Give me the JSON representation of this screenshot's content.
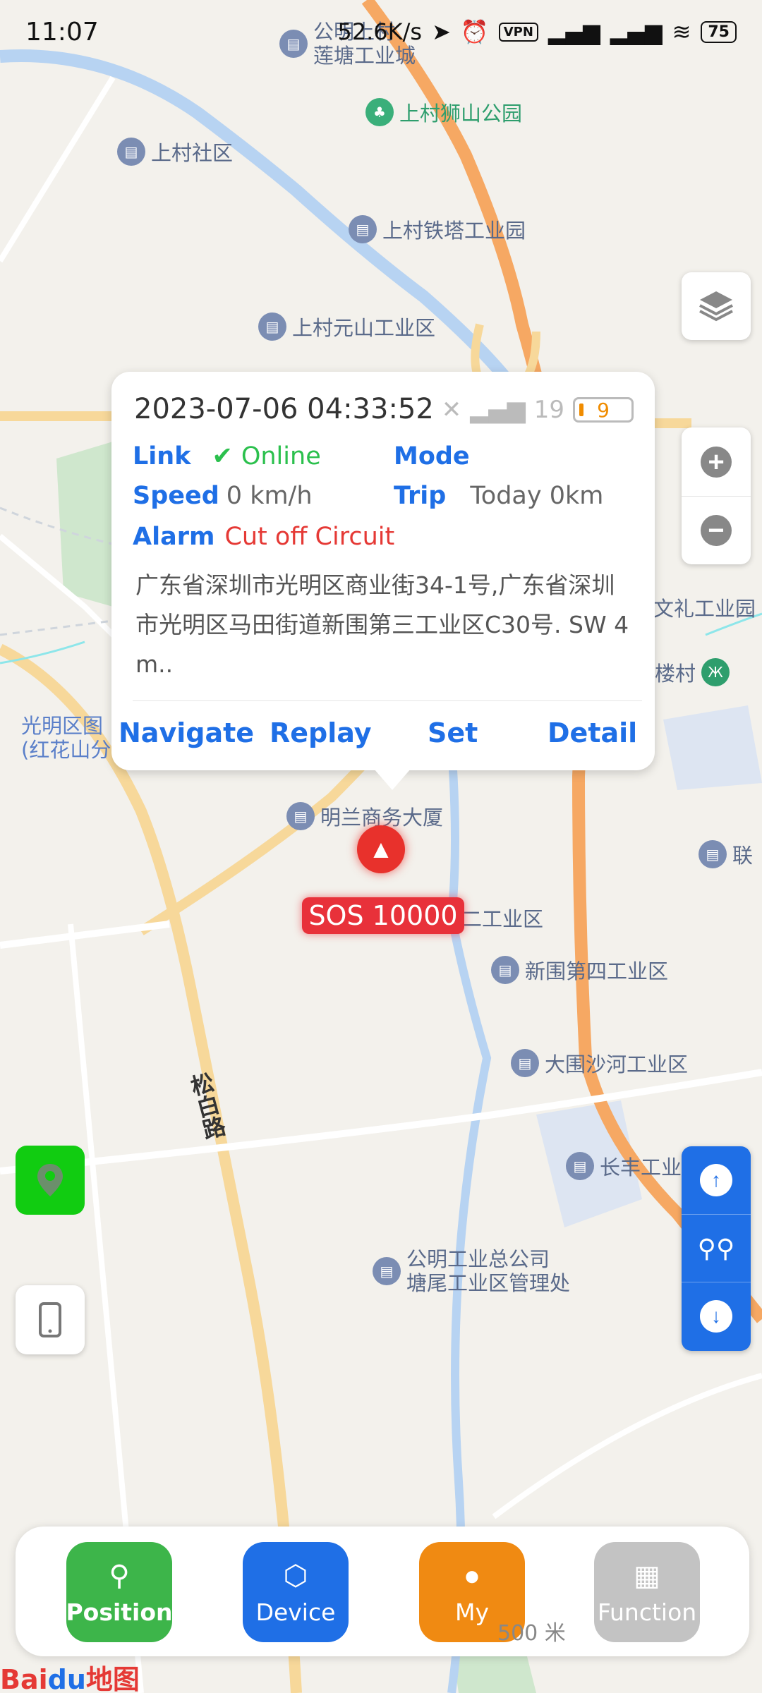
{
  "status_bar": {
    "time": "11:07",
    "speed": "52.6K/s",
    "vpn": "VPN",
    "battery": "75"
  },
  "map": {
    "pois": [
      {
        "name": "公明上村\n莲塘工业城",
        "type": "building"
      },
      {
        "name": "上村狮山公园",
        "type": "park"
      },
      {
        "name": "上村社区",
        "type": "building"
      },
      {
        "name": "上村铁塔工业园",
        "type": "building"
      },
      {
        "name": "上村元山工业区",
        "type": "building"
      },
      {
        "name": "文礼工业园",
        "type": "building"
      },
      {
        "name": "楼村",
        "type": "metro"
      },
      {
        "name": "光明区图\n(红花山分",
        "type": "building"
      },
      {
        "name": "明兰商务大厦",
        "type": "building"
      },
      {
        "name": "联",
        "type": "building"
      },
      {
        "name": "二工业区",
        "type": "building"
      },
      {
        "name": "新围第四工业区",
        "type": "building"
      },
      {
        "name": "大围沙河工业区",
        "type": "building"
      },
      {
        "name": "长丰工业",
        "type": "building"
      },
      {
        "name": "公明工业总公司\n塘尾工业区管理处",
        "type": "building"
      }
    ],
    "road_label": "松白路",
    "scale_text": "500 米",
    "brand": {
      "bai": "Bai",
      "du": "du",
      "suffix": "地图"
    }
  },
  "device_card": {
    "datetime": "2023-07-06 04:33:52",
    "signal": "19",
    "battery": "9",
    "link_label": "Link",
    "link_value": "Online",
    "mode_label": "Mode",
    "mode_value": "",
    "speed_label": "Speed",
    "speed_value": "0 km/h",
    "trip_label": "Trip",
    "trip_value": "Today 0km",
    "alarm_label": "Alarm",
    "alarm_value": "Cut off Circuit",
    "address": "广东省深圳市光明区商业街34-1号,广东省深圳市光明区马田街道新围第三工业区C30号. SW 4 m..",
    "actions": [
      "Navigate",
      "Replay",
      "Set",
      "Detail"
    ]
  },
  "marker": {
    "label": "SOS 10000"
  },
  "bottom_nav": [
    {
      "label": "Position",
      "color": "#3db54a",
      "icon": "location-pin-icon"
    },
    {
      "label": "Device",
      "color": "#1f6fe6",
      "icon": "cube-icon"
    },
    {
      "label": "My",
      "color": "#f08a12",
      "icon": "person-icon"
    },
    {
      "label": "Function",
      "color": "#c3c3c3",
      "icon": "grid-icon"
    }
  ],
  "colors": {
    "accent_blue": "#1f6fe6",
    "online_green": "#2bc04d",
    "alarm_red": "#e53935"
  }
}
